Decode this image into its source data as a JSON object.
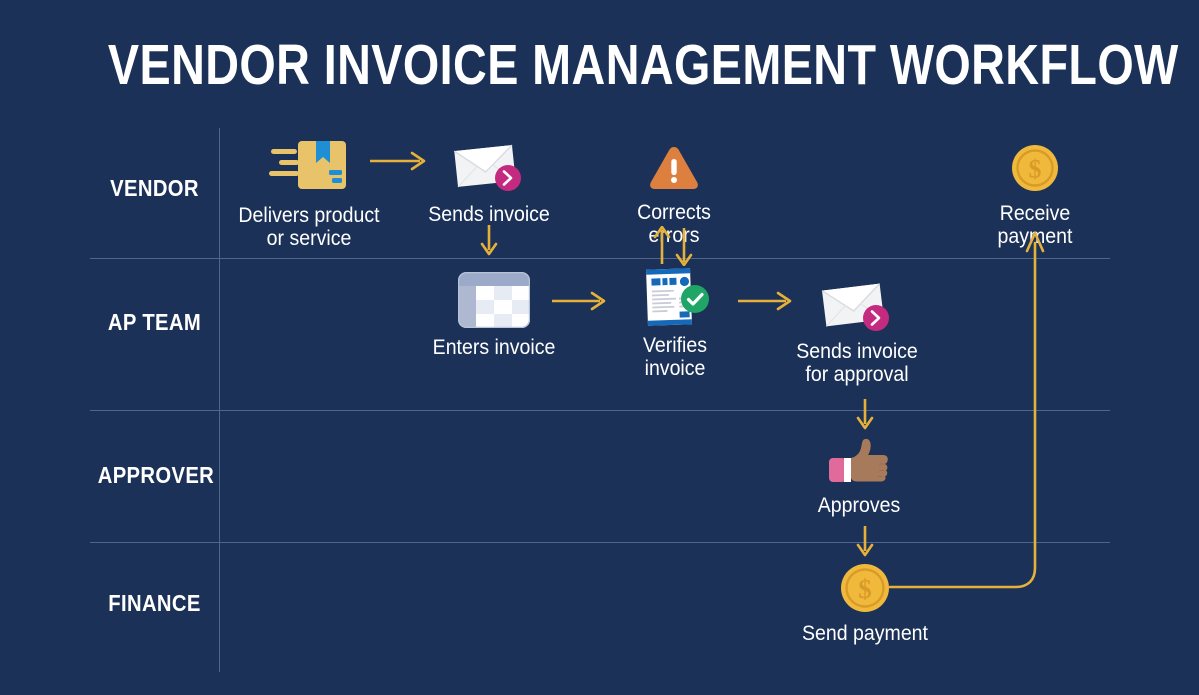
{
  "title": "VENDOR INVOICE MANAGEMENT WORKFLOW",
  "colors": {
    "background": "#1c3158",
    "divider": "#50658c",
    "arrow": "#e8b councils",
    "arrow_gold": "#e5b13a",
    "text": "#ffffff",
    "package_tan": "#e8c36a",
    "ribbon_blue": "#1e8fd5",
    "warning_orange": "#dd7f3f",
    "coin_gold": "#f0b93c",
    "coin_ring": "#d99b28",
    "badge_magenta": "#c42a80",
    "check_green": "#1fa566",
    "doc_blue": "#1569b8",
    "grid_blue": "#9aaac8",
    "skin_tan": "#a87a5c",
    "cuff_pink": "#e06a9a"
  },
  "lanes": [
    {
      "id": "vendor",
      "label": "VENDOR"
    },
    {
      "id": "ap-team",
      "label": "AP\nTEAM"
    },
    {
      "id": "approver",
      "label": "APPROVER"
    },
    {
      "id": "finance",
      "label": "FINANCE"
    }
  ],
  "steps": [
    {
      "id": "delivers-product",
      "lane": "vendor",
      "label": "Delivers product\nor service",
      "icon": "package-icon"
    },
    {
      "id": "sends-invoice",
      "lane": "vendor",
      "label": "Sends invoice",
      "icon": "envelope-send-icon"
    },
    {
      "id": "corrects-errors",
      "lane": "vendor",
      "label": "Corrects errors",
      "icon": "warning-triangle-icon"
    },
    {
      "id": "receive-payment",
      "lane": "vendor",
      "label": "Receive payment",
      "icon": "coin-dollar-icon"
    },
    {
      "id": "enters-invoice",
      "lane": "ap-team",
      "label": "Enters invoice",
      "icon": "spreadsheet-grid-icon"
    },
    {
      "id": "verifies-invoice",
      "lane": "ap-team",
      "label": "Verifies invoice",
      "icon": "invoice-check-icon"
    },
    {
      "id": "sends-approval",
      "lane": "ap-team",
      "label": "Sends invoice\nfor approval",
      "icon": "envelope-send-icon"
    },
    {
      "id": "approves",
      "lane": "approver",
      "label": "Approves",
      "icon": "thumbs-up-icon"
    },
    {
      "id": "send-payment",
      "lane": "finance",
      "label": "Send payment",
      "icon": "coin-dollar-icon"
    }
  ],
  "connectors": [
    {
      "id": "deliver-to-send",
      "type": "arrow-right"
    },
    {
      "id": "send-to-enter",
      "type": "arrow-down"
    },
    {
      "id": "enter-to-verify",
      "type": "arrow-right"
    },
    {
      "id": "verify-to-correct",
      "type": "arrow-up-down-pair"
    },
    {
      "id": "verify-to-sendapp",
      "type": "arrow-right"
    },
    {
      "id": "sendapp-to-approve",
      "type": "arrow-down"
    },
    {
      "id": "approve-to-pay",
      "type": "arrow-down"
    },
    {
      "id": "pay-to-receive",
      "type": "return-path-up"
    }
  ]
}
